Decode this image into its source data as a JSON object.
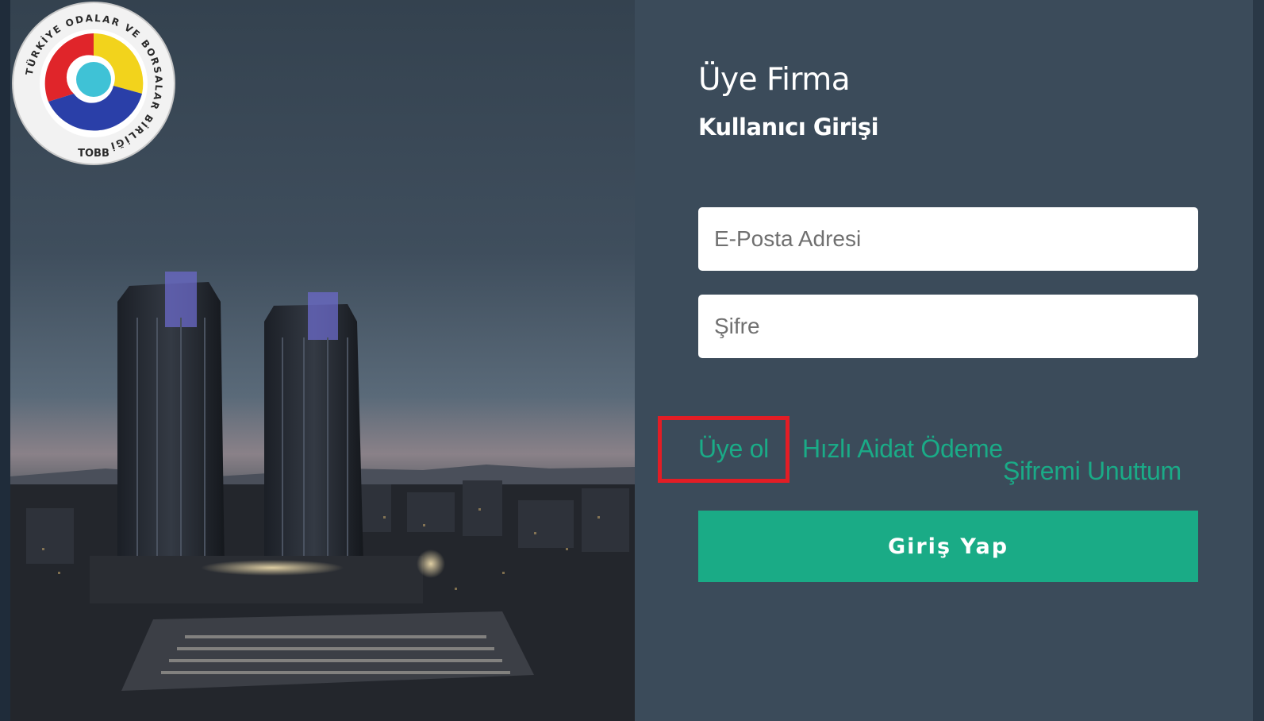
{
  "login": {
    "title": "Üye Firma",
    "subtitle": "Kullanıcı Girişi",
    "email_placeholder": "E-Posta Adresi",
    "password_placeholder": "Şifre",
    "register_link": "Üye ol",
    "quick_payment_link": "Hızlı Aidat Ödeme",
    "forgot_password_link": "Şifremi Unuttum",
    "submit_label": "Giriş Yap"
  },
  "logo": {
    "ring_text": "TÜRKİYE ODALAR VE BORSALAR BİRLİĞİ",
    "abbrev": "TOBB"
  },
  "colors": {
    "panel_bg": "#3b4b5a",
    "accent_green": "#1aab86",
    "highlight_red": "#e31d25"
  }
}
